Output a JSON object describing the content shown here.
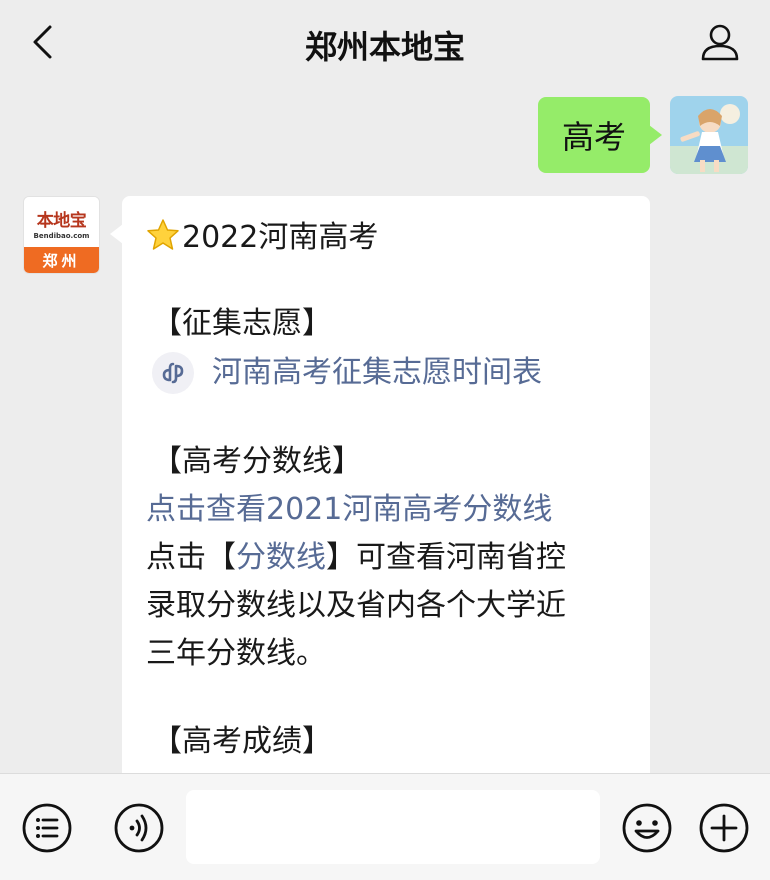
{
  "header": {
    "title": "郑州本地宝",
    "back_icon": "chevron-left-icon",
    "profile_icon": "person-icon"
  },
  "user_message": {
    "text": "高考",
    "bubble_color": "#95ec69"
  },
  "bot": {
    "avatar": {
      "logo_text": "本地宝",
      "logo_sub": "Bendibao.com",
      "city": "郑州",
      "accent": "#ef6b22"
    },
    "lines": {
      "l1": "2022河南高考",
      "l2": "【征集志愿】",
      "l3": "河南高考征集志愿时间表",
      "l4": "【高考分数线】",
      "l5": "点击查看2021河南高考分数线",
      "l6a": "点击【",
      "l6b": "分数线",
      "l6c": "】可查看河南省控",
      "l7": "录取分数线以及省内各个大学近",
      "l8": "三年分数线。",
      "l9": "【高考成绩】"
    },
    "link_color": "#576b95"
  },
  "input_bar": {
    "menu_icon": "menu-list-icon",
    "voice_icon": "voice-icon",
    "emoji_icon": "emoji-icon",
    "plus_icon": "plus-icon",
    "placeholder": ""
  }
}
